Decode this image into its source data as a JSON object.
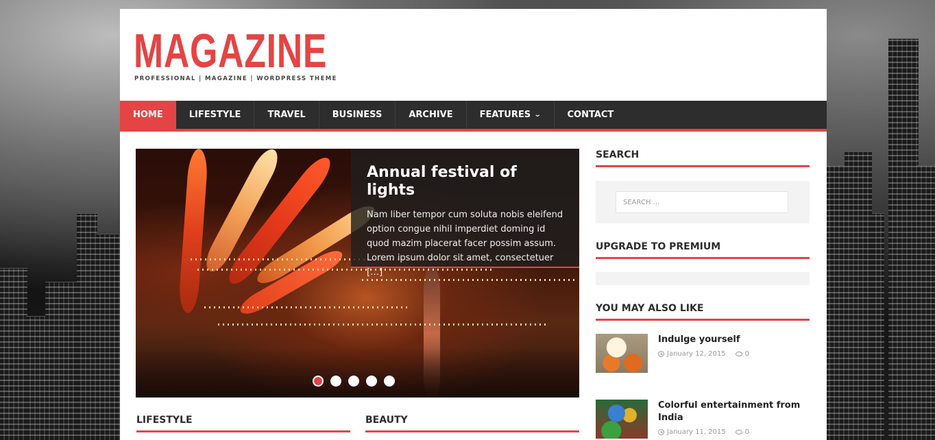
{
  "header": {
    "logo": "MAGAZINE",
    "tagline": "PROFESSIONAL | MAGAZINE | WORDPRESS THEME"
  },
  "nav": {
    "items": [
      {
        "label": "HOME",
        "active": true
      },
      {
        "label": "LIFESTYLE"
      },
      {
        "label": "TRAVEL"
      },
      {
        "label": "BUSINESS"
      },
      {
        "label": "ARCHIVE"
      },
      {
        "label": "FEATURES",
        "has_dropdown": true
      },
      {
        "label": "CONTACT"
      }
    ]
  },
  "slider": {
    "title": "Annual festival of lights",
    "excerpt": "Nam liber tempor cum soluta nobis eleifend option congue nihil imperdiet doming id quod mazim placerat facer possim assum. Lorem ipsum dolor sit amet, consectetuer […]",
    "dot_count": 5,
    "active_dot": 1
  },
  "sections": {
    "lifestyle": "LIFESTYLE",
    "beauty": "BEAUTY"
  },
  "sidebar": {
    "search_title": "SEARCH",
    "search_placeholder": "SEARCH ...",
    "premium_title": "UPGRADE TO PREMIUM",
    "also_like_title": "YOU MAY ALSO LIKE",
    "posts": [
      {
        "title": "Indulge yourself",
        "date": "January 12, 2015",
        "comments": "0"
      },
      {
        "title": "Colorful entertainment from India",
        "date": "January 11, 2015",
        "comments": "0"
      }
    ]
  },
  "colors": {
    "accent": "#e54444",
    "nav_bg": "#2d2d2d"
  }
}
